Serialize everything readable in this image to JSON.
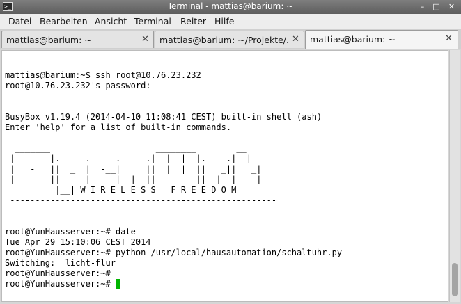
{
  "window": {
    "title": "Terminal - mattias@barium: ~",
    "buttons": {
      "minimize": "–",
      "maximize": "□",
      "close": "✕"
    }
  },
  "menu": [
    "Datei",
    "Bearbeiten",
    "Ansicht",
    "Terminal",
    "Reiter",
    "Hilfe"
  ],
  "tabs": [
    {
      "label": "mattias@barium: ~",
      "close": "✕"
    },
    {
      "label": "mattias@barium: ~/Projekte/...",
      "close": "✕"
    },
    {
      "label": "mattias@barium: ~",
      "close": "✕"
    }
  ],
  "terminal": {
    "lines": [
      "",
      "mattias@barium:~$ ssh root@10.76.23.232",
      "root@10.76.23.232's password:",
      "",
      "",
      "BusyBox v1.19.4 (2014-04-10 11:08:41 CEST) built-in shell (ash)",
      "Enter 'help' for a list of built-in commands.",
      "",
      "  _______                     ________        __",
      " |       |.-----.-----.-----.|  |  |  |.----.|  |_",
      " |   -   ||  _  |  -__|     ||  |  |  ||   _||   _|",
      " |_______||   __|_____|__|__||________||__|  |____|",
      "          |__| W I R E L E S S   F R E E D O M",
      " -----------------------------------------------------",
      "",
      "",
      "root@YunHausserver:~# date",
      "Tue Apr 29 15:10:06 CEST 2014",
      "root@YunHausserver:~# python /usr/local/hausautomation/schaltuhr.py",
      "Switching:  licht-flur",
      "root@YunHausserver:~#",
      "root@YunHausserver:~# "
    ]
  }
}
